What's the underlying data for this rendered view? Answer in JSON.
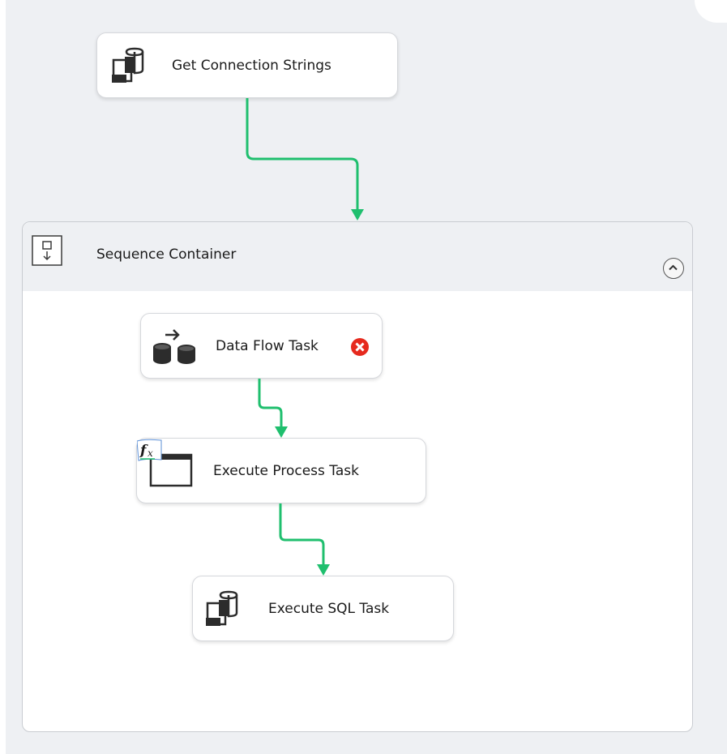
{
  "tasks": {
    "get_connection_strings": {
      "label": "Get Connection Strings",
      "icon": "execute-sql-icon"
    },
    "data_flow_task": {
      "label": "Data Flow Task",
      "icon": "data-flow-icon",
      "status_icon": "error-icon"
    },
    "execute_process_task": {
      "label": "Execute Process Task",
      "icon": "execute-process-icon"
    },
    "execute_sql_task": {
      "label": "Execute SQL Task",
      "icon": "execute-sql-icon"
    }
  },
  "container": {
    "title": "Sequence Container",
    "icon": "sequence-container-icon",
    "collapse_icon": "chevron-up-icon"
  },
  "colors": {
    "precedence_success": "#1fbf6e",
    "error": "#e62a1e",
    "canvas": "#eef0f3"
  }
}
